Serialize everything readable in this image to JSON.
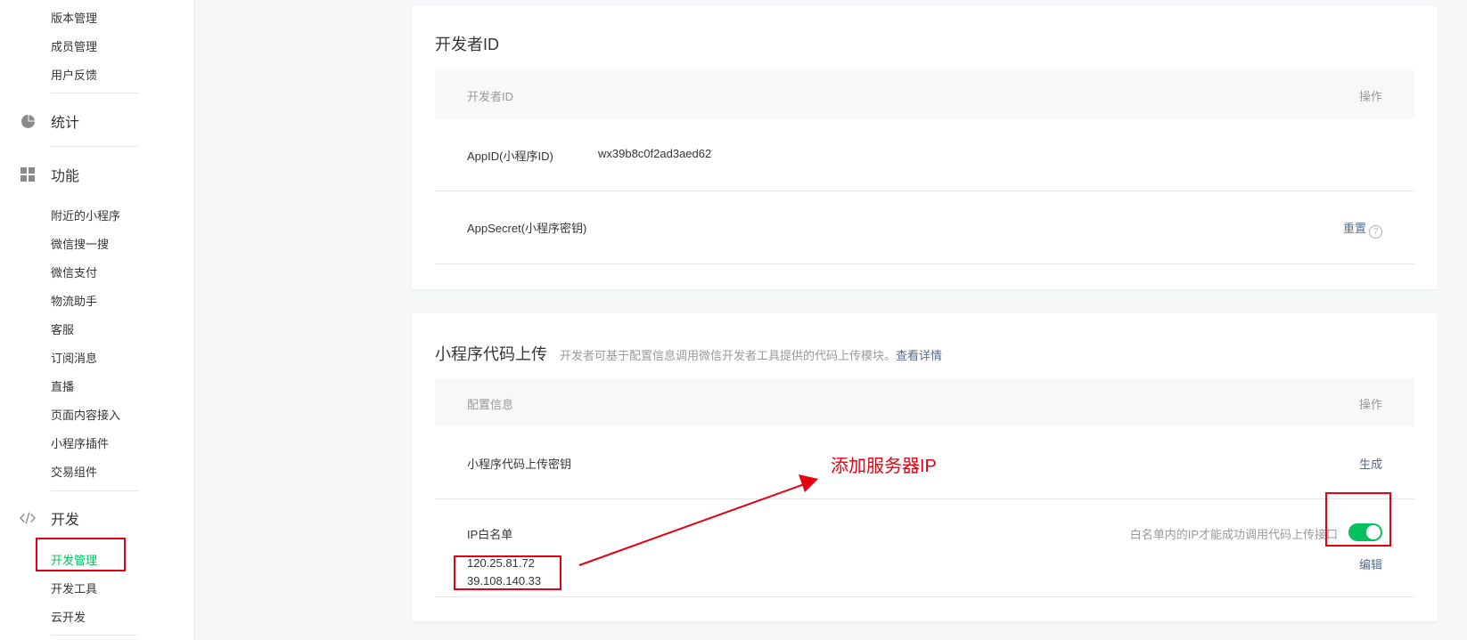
{
  "sidebar": {
    "top_items": [
      "版本管理",
      "成员管理",
      "用户反馈"
    ],
    "stats_group": {
      "label": "统计",
      "icon": "pie-chart-icon"
    },
    "feature_group": {
      "label": "功能",
      "icon": "grid-icon",
      "items": [
        "附近的小程序",
        "微信搜一搜",
        "微信支付",
        "物流助手",
        "客服",
        "订阅消息",
        "直播",
        "页面内容接入",
        "小程序插件",
        "交易组件"
      ]
    },
    "dev_group": {
      "label": "开发",
      "icon": "code-icon",
      "items": [
        "开发管理",
        "开发工具",
        "云开发"
      ],
      "active_item": "开发管理"
    }
  },
  "developer_id_card": {
    "title": "开发者ID",
    "header": {
      "left": "开发者ID",
      "right": "操作"
    },
    "rows": [
      {
        "label": "AppID(小程序ID)",
        "value": "wx39b8c0f2ad3aed62"
      },
      {
        "label": "AppSecret(小程序密钥)",
        "action": "重置",
        "help": "?"
      }
    ]
  },
  "upload_card": {
    "title": "小程序代码上传",
    "description": "开发者可基于配置信息调用微信开发者工具提供的代码上传模块。",
    "description_link": "查看详情",
    "header": {
      "left": "配置信息",
      "right": "操作"
    },
    "key_row": {
      "label": "小程序代码上传密钥",
      "action": "生成"
    },
    "whitelist_row": {
      "label": "IP白名单",
      "hint": "白名单内的IP才能成功调用代码上传接口",
      "toggle_on": true,
      "ips": [
        "120.25.81.72",
        "39.108.140.33"
      ],
      "action": "编辑"
    }
  },
  "annotation": {
    "text": "添加服务器IP",
    "color": "#e60012"
  },
  "colors": {
    "accent_green": "#07c160",
    "link_blue": "#576b95",
    "annotation_red": "#e60012"
  }
}
